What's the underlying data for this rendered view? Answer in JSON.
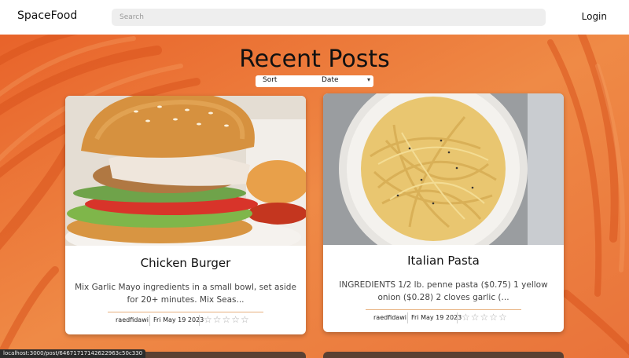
{
  "app": {
    "brand": "SpaceFood",
    "login_label": "Login"
  },
  "search": {
    "placeholder": "Search",
    "value": ""
  },
  "page": {
    "title": "Recent Posts"
  },
  "sort": {
    "label": "Sort",
    "selected": "Date"
  },
  "posts": [
    {
      "title": "Chicken Burger",
      "description": "Mix Garlic Mayo ingredients in a small bowl, set aside for 20+ minutes. Mix Seas...",
      "author": "raedfidawi",
      "date": "Fri May 19 2023",
      "rating_stars": "☆☆☆☆☆",
      "image_icon": "burger-photo"
    },
    {
      "title": "Italian Pasta",
      "description": "INGREDIENTS 1/2 lb. penne pasta ($0.75) 1 yellow onion ($0.28) 2 cloves garlic (...",
      "author": "raedfidawi",
      "date": "Fri May 19 2023",
      "rating_stars": "☆☆☆☆☆",
      "image_icon": "pasta-photo"
    }
  ],
  "status_bar": {
    "url": "localhost:3000/post/64671717142622963c50c330"
  },
  "colors": {
    "background": "#ec7a3c",
    "accent_line": "#e7b07d",
    "topbar": "#ffffff"
  }
}
